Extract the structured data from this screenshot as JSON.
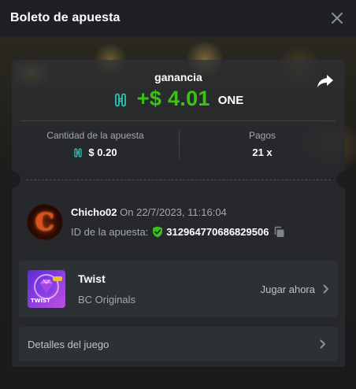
{
  "header": {
    "title": "Boleto de apuesta"
  },
  "payout": {
    "label": "ganancia",
    "amount": "+$ 4.01",
    "currency": "ONE"
  },
  "stats": {
    "bet_amount_label": "Cantidad de la apuesta",
    "bet_amount_value": "$ 0.20",
    "payout_label": "Pagos",
    "payout_value": "21 x"
  },
  "user": {
    "avatar_letter": "C",
    "username": "Chicho02",
    "on_date": "On 22/7/2023, 11:16:04",
    "bet_id_label": "ID de la apuesta:",
    "bet_id": "312964770686829506"
  },
  "game": {
    "thumb_text": "TWIST",
    "name": "Twist",
    "provider": "BC Originals",
    "play_label": "Jugar ahora"
  },
  "details": {
    "label": "Detalles del juego"
  },
  "colors": {
    "accent_green": "#3bc117",
    "coin_teal": "#2ec4b6",
    "shield_green": "#3bc117"
  },
  "icons": {
    "close": "close-icon",
    "share": "share-icon",
    "coin": "harmony-one-coin-icon",
    "shield": "verified-shield-icon",
    "copy": "copy-icon",
    "chevron": "chevron-right-icon"
  }
}
